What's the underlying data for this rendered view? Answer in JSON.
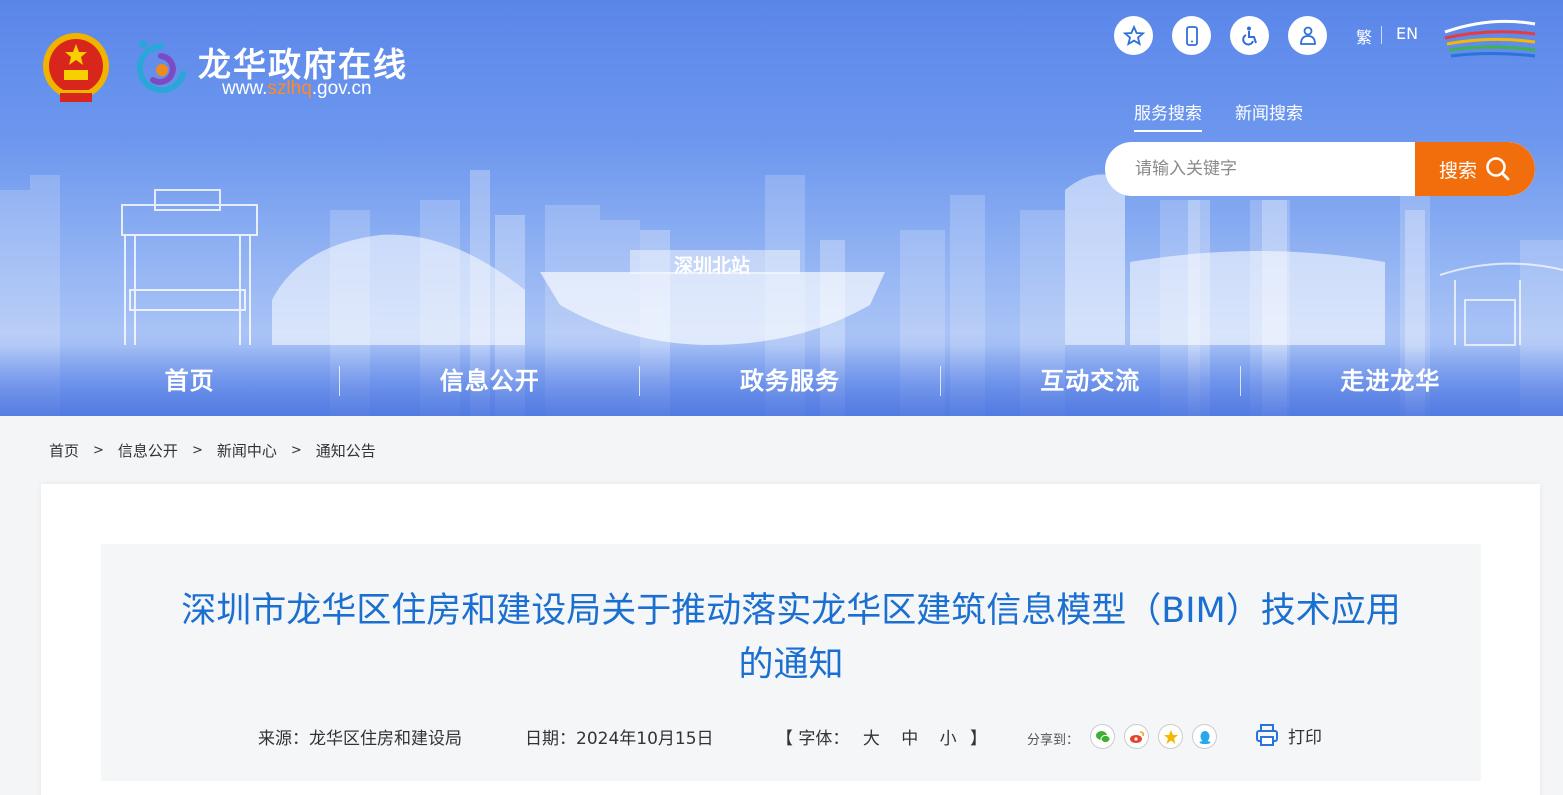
{
  "header": {
    "site_name": "龙华政府在线",
    "url_prefix": "www.",
    "url_highlight": "szlhq",
    "url_suffix": ".gov.cn",
    "station_sign": "深圳北站",
    "tools": [
      "favorite-icon",
      "mobile-icon",
      "accessibility-icon",
      "elder-care-icon"
    ],
    "lang_traditional": "繁",
    "lang_english": "EN"
  },
  "search": {
    "tabs": [
      "服务搜索",
      "新闻搜索"
    ],
    "active_tab": "服务搜索",
    "placeholder": "请输入关键字",
    "button_label": "搜索"
  },
  "nav": {
    "items": [
      "首页",
      "信息公开",
      "政务服务",
      "互动交流",
      "走进龙华"
    ]
  },
  "breadcrumb": {
    "items": [
      "首页",
      "信息公开",
      "新闻中心",
      "通知公告"
    ],
    "separator": ">"
  },
  "article": {
    "title_line1": "深圳市龙华区住房和建设局关于推动落实龙华区建筑信息模型（BIM）技术应用",
    "title_line2": "的通知",
    "source_label": "来源：",
    "source": "龙华区住房和建设局",
    "date_label": "日期：",
    "date": "2024年10月15日",
    "font_open": "【 字体：",
    "font_large": "大",
    "font_medium": "中",
    "font_small": "小",
    "font_close": "】",
    "share_label": "分享到：",
    "share_targets": [
      "wechat-icon",
      "weibo-icon",
      "qzone-icon",
      "qq-icon"
    ],
    "print_label": "打印"
  },
  "colors": {
    "banner_blue": "#5a86ea",
    "search_orange": "#f26e0c",
    "title_blue": "#1a6fd1",
    "url_highlight": "#ff8a26"
  }
}
